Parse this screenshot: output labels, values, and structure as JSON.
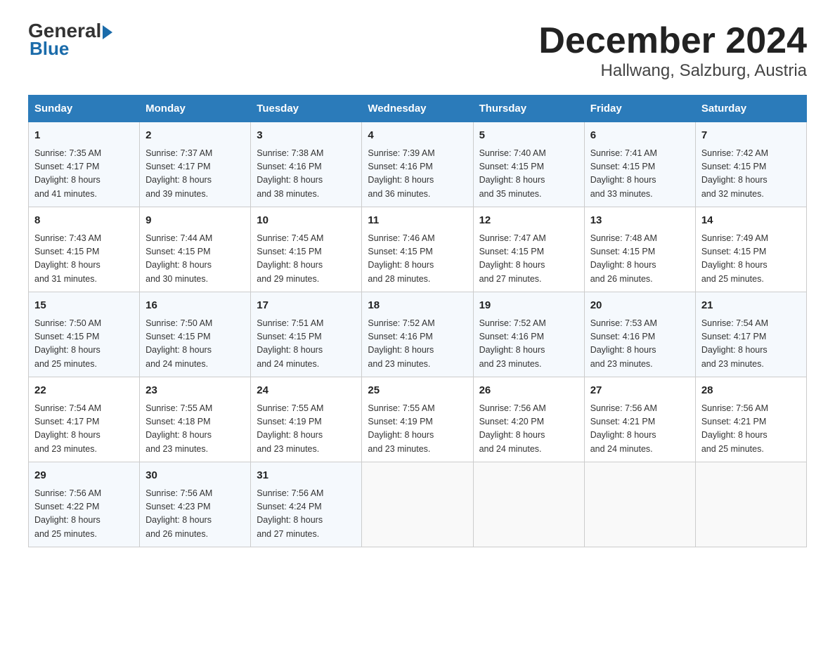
{
  "header": {
    "logo": {
      "general": "General",
      "blue": "Blue"
    },
    "month_title": "December 2024",
    "location": "Hallwang, Salzburg, Austria"
  },
  "weekdays": [
    "Sunday",
    "Monday",
    "Tuesday",
    "Wednesday",
    "Thursday",
    "Friday",
    "Saturday"
  ],
  "weeks": [
    [
      {
        "day": "1",
        "sunrise": "7:35 AM",
        "sunset": "4:17 PM",
        "daylight": "8 hours and 41 minutes."
      },
      {
        "day": "2",
        "sunrise": "7:37 AM",
        "sunset": "4:17 PM",
        "daylight": "8 hours and 39 minutes."
      },
      {
        "day": "3",
        "sunrise": "7:38 AM",
        "sunset": "4:16 PM",
        "daylight": "8 hours and 38 minutes."
      },
      {
        "day": "4",
        "sunrise": "7:39 AM",
        "sunset": "4:16 PM",
        "daylight": "8 hours and 36 minutes."
      },
      {
        "day": "5",
        "sunrise": "7:40 AM",
        "sunset": "4:15 PM",
        "daylight": "8 hours and 35 minutes."
      },
      {
        "day": "6",
        "sunrise": "7:41 AM",
        "sunset": "4:15 PM",
        "daylight": "8 hours and 33 minutes."
      },
      {
        "day": "7",
        "sunrise": "7:42 AM",
        "sunset": "4:15 PM",
        "daylight": "8 hours and 32 minutes."
      }
    ],
    [
      {
        "day": "8",
        "sunrise": "7:43 AM",
        "sunset": "4:15 PM",
        "daylight": "8 hours and 31 minutes."
      },
      {
        "day": "9",
        "sunrise": "7:44 AM",
        "sunset": "4:15 PM",
        "daylight": "8 hours and 30 minutes."
      },
      {
        "day": "10",
        "sunrise": "7:45 AM",
        "sunset": "4:15 PM",
        "daylight": "8 hours and 29 minutes."
      },
      {
        "day": "11",
        "sunrise": "7:46 AM",
        "sunset": "4:15 PM",
        "daylight": "8 hours and 28 minutes."
      },
      {
        "day": "12",
        "sunrise": "7:47 AM",
        "sunset": "4:15 PM",
        "daylight": "8 hours and 27 minutes."
      },
      {
        "day": "13",
        "sunrise": "7:48 AM",
        "sunset": "4:15 PM",
        "daylight": "8 hours and 26 minutes."
      },
      {
        "day": "14",
        "sunrise": "7:49 AM",
        "sunset": "4:15 PM",
        "daylight": "8 hours and 25 minutes."
      }
    ],
    [
      {
        "day": "15",
        "sunrise": "7:50 AM",
        "sunset": "4:15 PM",
        "daylight": "8 hours and 25 minutes."
      },
      {
        "day": "16",
        "sunrise": "7:50 AM",
        "sunset": "4:15 PM",
        "daylight": "8 hours and 24 minutes."
      },
      {
        "day": "17",
        "sunrise": "7:51 AM",
        "sunset": "4:15 PM",
        "daylight": "8 hours and 24 minutes."
      },
      {
        "day": "18",
        "sunrise": "7:52 AM",
        "sunset": "4:16 PM",
        "daylight": "8 hours and 23 minutes."
      },
      {
        "day": "19",
        "sunrise": "7:52 AM",
        "sunset": "4:16 PM",
        "daylight": "8 hours and 23 minutes."
      },
      {
        "day": "20",
        "sunrise": "7:53 AM",
        "sunset": "4:16 PM",
        "daylight": "8 hours and 23 minutes."
      },
      {
        "day": "21",
        "sunrise": "7:54 AM",
        "sunset": "4:17 PM",
        "daylight": "8 hours and 23 minutes."
      }
    ],
    [
      {
        "day": "22",
        "sunrise": "7:54 AM",
        "sunset": "4:17 PM",
        "daylight": "8 hours and 23 minutes."
      },
      {
        "day": "23",
        "sunrise": "7:55 AM",
        "sunset": "4:18 PM",
        "daylight": "8 hours and 23 minutes."
      },
      {
        "day": "24",
        "sunrise": "7:55 AM",
        "sunset": "4:19 PM",
        "daylight": "8 hours and 23 minutes."
      },
      {
        "day": "25",
        "sunrise": "7:55 AM",
        "sunset": "4:19 PM",
        "daylight": "8 hours and 23 minutes."
      },
      {
        "day": "26",
        "sunrise": "7:56 AM",
        "sunset": "4:20 PM",
        "daylight": "8 hours and 24 minutes."
      },
      {
        "day": "27",
        "sunrise": "7:56 AM",
        "sunset": "4:21 PM",
        "daylight": "8 hours and 24 minutes."
      },
      {
        "day": "28",
        "sunrise": "7:56 AM",
        "sunset": "4:21 PM",
        "daylight": "8 hours and 25 minutes."
      }
    ],
    [
      {
        "day": "29",
        "sunrise": "7:56 AM",
        "sunset": "4:22 PM",
        "daylight": "8 hours and 25 minutes."
      },
      {
        "day": "30",
        "sunrise": "7:56 AM",
        "sunset": "4:23 PM",
        "daylight": "8 hours and 26 minutes."
      },
      {
        "day": "31",
        "sunrise": "7:56 AM",
        "sunset": "4:24 PM",
        "daylight": "8 hours and 27 minutes."
      },
      null,
      null,
      null,
      null
    ]
  ],
  "labels": {
    "sunrise": "Sunrise:",
    "sunset": "Sunset:",
    "daylight": "Daylight:"
  }
}
